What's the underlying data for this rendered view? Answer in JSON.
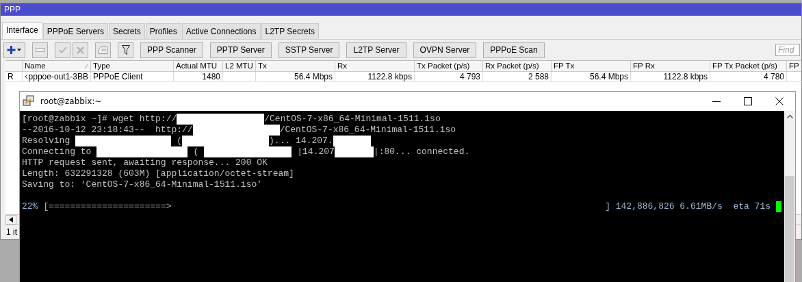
{
  "ppp_window": {
    "title": "PPP",
    "tabs": [
      {
        "label": "Interface",
        "selected": true
      },
      {
        "label": "PPPoE Servers",
        "selected": false
      },
      {
        "label": "Secrets",
        "selected": false
      },
      {
        "label": "Profiles",
        "selected": false
      },
      {
        "label": "Active Connections",
        "selected": false
      },
      {
        "label": "L2TP Secrets",
        "selected": false
      }
    ],
    "toolbar_buttons": [
      "PPP Scanner",
      "PPTP Server",
      "SSTP Server",
      "L2TP Server",
      "OVPN Server",
      "PPPoE Scan"
    ],
    "find": {
      "placeholder": "Find"
    },
    "table": {
      "columns": [
        "",
        "Name",
        "Type",
        "Actual MTU",
        "L2 MTU",
        "Tx",
        "Rx",
        "Tx Packet (p/s)",
        "Rx Packet (p/s)",
        "FP Tx",
        "FP Rx",
        "FP Tx Packet (p/s)",
        "FP"
      ],
      "rows": [
        {
          "cells": [
            "R",
            "pppoe-out1-3BB",
            "PPPoE Client",
            "1480",
            "",
            "56.4 Mbps",
            "1122.8 kbps",
            "4 793",
            "2 588",
            "56.4 Mbps",
            "1122.8 kbps",
            "4 780",
            ""
          ]
        }
      ]
    },
    "status_bar": "1 it"
  },
  "terminal_window": {
    "title": "root@zabbix:~",
    "lines": [
      {
        "segments": [
          {
            "kind": "text",
            "text": "[root@zabbix ~]# wget http://"
          },
          {
            "kind": "redacted"
          },
          {
            "kind": "text",
            "text": "/CentOS-7-x86_64-Minimal-1511.iso"
          }
        ]
      },
      {
        "segments": [
          {
            "kind": "text",
            "text": "--2016-10-12 23:18:43--  http://"
          },
          {
            "kind": "redacted"
          },
          {
            "kind": "text",
            "text": "/CentOS-7-x86_64-Minimal-1511.iso"
          }
        ]
      },
      {
        "segments": [
          {
            "kind": "text",
            "text": "Resolving"
          },
          {
            "kind": "redacted"
          },
          {
            "kind": "text",
            "text": "("
          },
          {
            "kind": "redacted"
          },
          {
            "kind": "text",
            "text": ")... 14.207."
          },
          {
            "kind": "redacted"
          }
        ]
      },
      {
        "segments": [
          {
            "kind": "text",
            "text": "Connecting to"
          },
          {
            "kind": "redacted"
          },
          {
            "kind": "text",
            "text": "("
          },
          {
            "kind": "redacted"
          },
          {
            "kind": "text",
            "text": "|14.207"
          },
          {
            "kind": "redacted"
          },
          {
            "kind": "text",
            "text": "|:80... connected."
          }
        ]
      },
      {
        "segments": [
          {
            "kind": "text",
            "text": "HTTP request sent, awaiting response... 200 OK"
          }
        ]
      },
      {
        "segments": [
          {
            "kind": "text",
            "text": "Length: 632291328 (603M) [application/octet-stream]"
          }
        ]
      },
      {
        "segments": [
          {
            "kind": "text",
            "text": "Saving to: ‘CentOS-7-x86_64-Minimal-1511.iso’"
          }
        ]
      }
    ],
    "progress": {
      "percent": "22%",
      "bar": "[======================>",
      "stats": "] 142,886,826 6.61MB/s  eta 71s"
    }
  }
}
